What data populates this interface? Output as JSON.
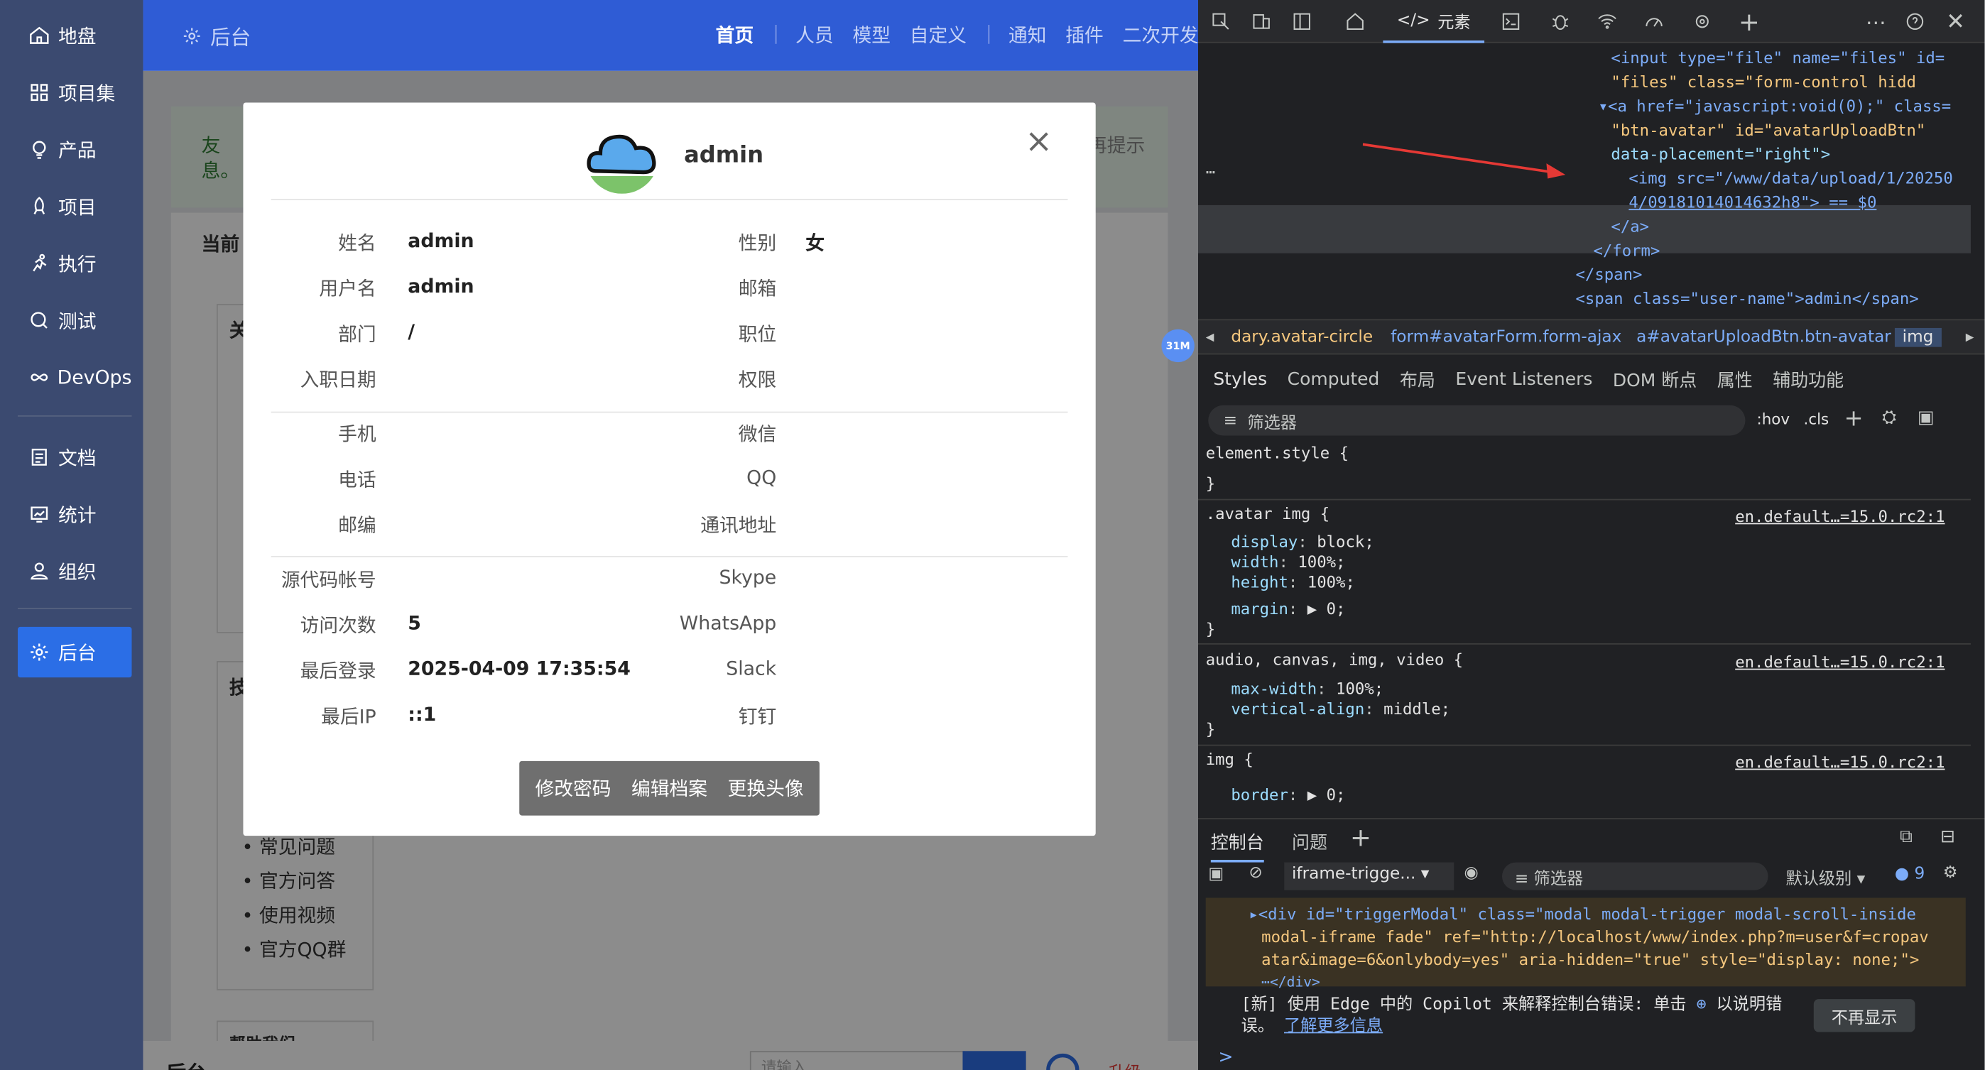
{
  "app": {
    "brand": "后台",
    "top_nav": [
      "首页",
      "人员",
      "模型",
      "自定义",
      "通知",
      "插件",
      "二次开发"
    ],
    "sidebar": [
      "地盘",
      "项目集",
      "产品",
      "项目",
      "执行",
      "测试",
      "DevOps",
      "文档",
      "统计",
      "组织",
      "后台"
    ],
    "bg_texts": {
      "notice_start": "友",
      "notice_end": "息。",
      "notice_right": "再提示",
      "current": "当前",
      "s1": "关",
      "s2": "技",
      "links": [
        "常见问题",
        "官方问答",
        "使用视频",
        "官方QQ群"
      ],
      "help": "帮助我们"
    },
    "bottom": {
      "title": "后台",
      "search_placeholder": "请输入",
      "upgrade": "升级"
    },
    "badge": "31M"
  },
  "modal": {
    "username": "admin",
    "close": "×",
    "left_fields": [
      {
        "label": "姓名",
        "value": "admin"
      },
      {
        "label": "用户名",
        "value": "admin"
      },
      {
        "label": "部门",
        "value": "/"
      },
      {
        "label": "入职日期",
        "value": ""
      },
      {
        "label": "手机",
        "value": ""
      },
      {
        "label": "电话",
        "value": ""
      },
      {
        "label": "邮编",
        "value": ""
      },
      {
        "label": "源代码帐号",
        "value": ""
      },
      {
        "label": "访问次数",
        "value": "5"
      },
      {
        "label": "最后登录",
        "value": "2025-04-09 17:35:54"
      },
      {
        "label": "最后IP",
        "value": "::1"
      }
    ],
    "right_fields": [
      {
        "label": "性别",
        "value": "女"
      },
      {
        "label": "邮箱",
        "value": ""
      },
      {
        "label": "职位",
        "value": ""
      },
      {
        "label": "权限",
        "value": ""
      },
      {
        "label": "微信",
        "value": ""
      },
      {
        "label": "QQ",
        "value": ""
      },
      {
        "label": "通讯地址",
        "value": ""
      },
      {
        "label": "Skype",
        "value": ""
      },
      {
        "label": "WhatsApp",
        "value": ""
      },
      {
        "label": "Slack",
        "value": ""
      },
      {
        "label": "钉钉",
        "value": ""
      }
    ],
    "buttons": [
      "修改密码",
      "编辑档案",
      "更换头像"
    ]
  },
  "devtools": {
    "elements_tab": "元素",
    "dom": [
      "<input type=\"file\" name=\"files\" id=",
      "\"files\" class=\"form-control hidd",
      "<a href=\"javascript:void(0);\" class=",
      "\"btn-avatar\" id=\"avatarUploadBtn\"",
      "data-placement=\"right\">",
      "<img src=\"/www/data/upload/1/20250",
      "4/09181014014632h8\"> == $0",
      "</a>",
      "</form>",
      "</span>",
      "<span class=\"user-name\">admin</span>"
    ],
    "crumbs": [
      "dary.avatar-circle",
      "form#avatarForm.form-ajax",
      "a#avatarUploadBtn.btn-avatar",
      "img"
    ],
    "subtabs": [
      "Styles",
      "Computed",
      "布局",
      "Event Listeners",
      "DOM 断点",
      "属性",
      "辅助功能"
    ],
    "filter": "筛选器",
    "hov": ":hov",
    "cls": ".cls",
    "styles": {
      "element_style": "element.style {",
      "close": "}",
      "rule1_sel": ".avatar img {",
      "rule1_src": "en.default…=15.0.rc2:1",
      "rule1_props": [
        [
          "display",
          "block;"
        ],
        [
          "width",
          "100%;"
        ],
        [
          "height",
          "100%;"
        ],
        [
          "margin",
          "▶ 0;"
        ]
      ],
      "rule2_sel": "audio, canvas, img, video {",
      "rule2_src": "en.default…=15.0.rc2:1",
      "rule2_props": [
        [
          "max-width",
          "100%;"
        ],
        [
          "vertical-align",
          "middle;"
        ]
      ],
      "rule3_sel": "img {",
      "rule3_src": "en.default…=15.0.rc2:1",
      "rule3_props": [
        [
          "border",
          "▶ 0;"
        ]
      ]
    },
    "console": {
      "tab_console": "控制台",
      "tab_issues": "问题",
      "context": "iframe-trigge...",
      "filter": "筛选器",
      "level": "默认级别",
      "count": "9",
      "msg": [
        "▸<div id=\"triggerModal\" class=\"modal modal-trigger  modal-scroll-inside",
        "modal-iframe fade\" ref=\"http://localhost/www/index.php?m=user&f=cropav",
        "atar&image=6&onlybody=yes\" aria-hidden=\"true\" style=\"display: none;\">",
        "⋯</div>"
      ],
      "copilot1": "[新] 使用 Edge 中的 Copilot 来解释控制台错误: 单击",
      "copilot2": "以说明错",
      "copilot3": "误。",
      "copilot_link": "了解更多信息",
      "dismiss": "不再显示",
      "prompt": ">"
    }
  }
}
